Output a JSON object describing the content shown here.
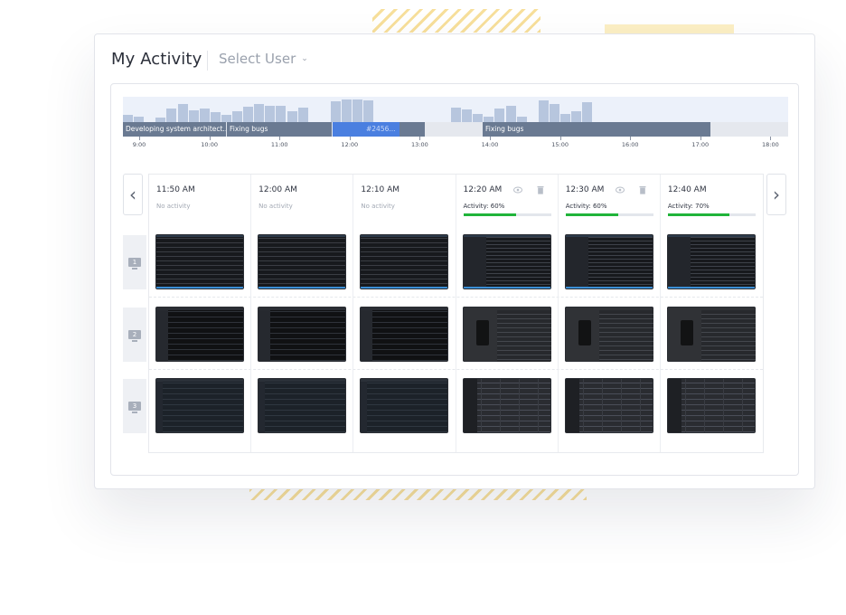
{
  "header": {
    "title": "My Activity",
    "select_user": "Select User"
  },
  "timeline": {
    "segments": [
      {
        "label": "Developing system architect..."
      },
      {
        "label": "Fixing bugs"
      },
      {
        "label": "#2456..."
      },
      {
        "label": ""
      },
      {
        "label": "Fixing bugs"
      },
      {
        "label": ""
      }
    ],
    "hours": [
      "9:00",
      "10:00",
      "11:00",
      "12:00",
      "13:00",
      "14:00",
      "15:00",
      "16:00",
      "17:00",
      "18:00"
    ]
  },
  "nav": {
    "prev": "‹",
    "next": "›"
  },
  "columns": [
    {
      "time": "11:50 AM",
      "status": "No activity"
    },
    {
      "time": "12:00 AM",
      "status": "No activity"
    },
    {
      "time": "12:10 AM",
      "status": "No activity"
    },
    {
      "time": "12:20 AM",
      "status": "Activity: 60%",
      "activity": 60
    },
    {
      "time": "12:30 AM",
      "status": "Activity: 60%",
      "activity": 60
    },
    {
      "time": "12:40 AM",
      "status": "Activity: 70%",
      "activity": 70
    }
  ],
  "screens": [
    "1",
    "2",
    "3"
  ],
  "colors": {
    "progress": "#20b43a",
    "segment": "#6a7a92",
    "segment_active": "#4a7fe0"
  },
  "icons": [
    "chevron-down-icon",
    "eye-icon",
    "trash-icon",
    "chevron-left-icon",
    "chevron-right-icon",
    "monitor-icon"
  ]
}
